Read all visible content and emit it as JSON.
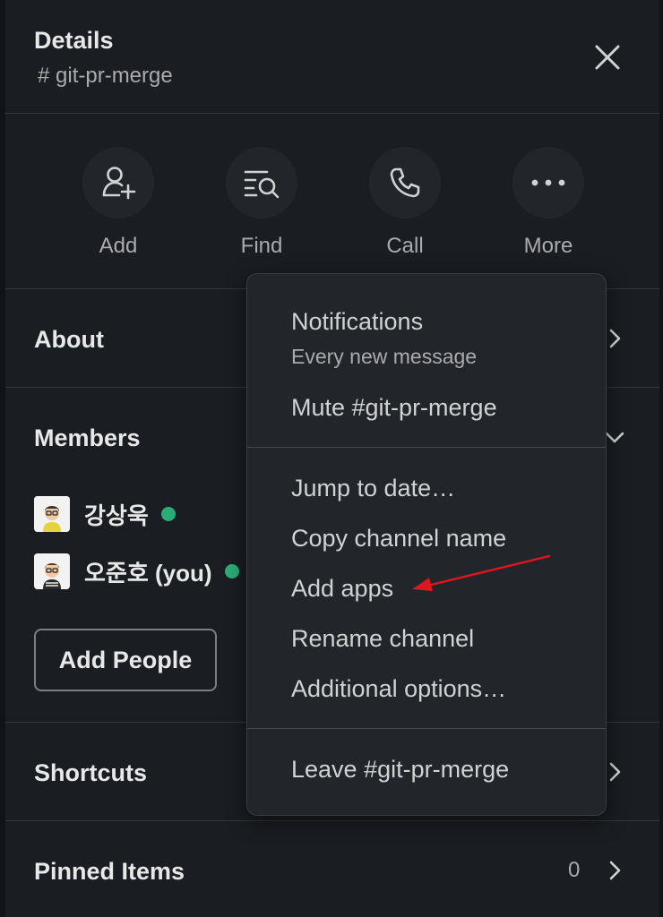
{
  "header": {
    "title": "Details",
    "channel": "# git-pr-merge"
  },
  "actions": [
    {
      "label": "Add",
      "icon": "add-person-icon"
    },
    {
      "label": "Find",
      "icon": "find-in-list-icon"
    },
    {
      "label": "Call",
      "icon": "phone-icon"
    },
    {
      "label": "More",
      "icon": "more-dots-icon"
    }
  ],
  "sections": {
    "about": "About",
    "members": "Members",
    "shortcuts": "Shortcuts",
    "pinned": "Pinned Items",
    "pinned_count": "0"
  },
  "members": [
    {
      "name": "강상욱",
      "online": true
    },
    {
      "name": "오준호 (you)",
      "online": true
    }
  ],
  "add_people_label": "Add People",
  "menu": {
    "notifications": "Notifications",
    "notifications_sub": "Every new message",
    "mute": "Mute #git-pr-merge",
    "jump_to_date": "Jump to date…",
    "copy_name": "Copy channel name",
    "add_apps": "Add apps",
    "rename": "Rename channel",
    "additional": "Additional options…",
    "leave": "Leave #git-pr-merge"
  },
  "colors": {
    "background": "#1a1d21",
    "menu_bg": "#222529",
    "online": "#2bac76",
    "annotation_arrow": "#e0161e"
  }
}
